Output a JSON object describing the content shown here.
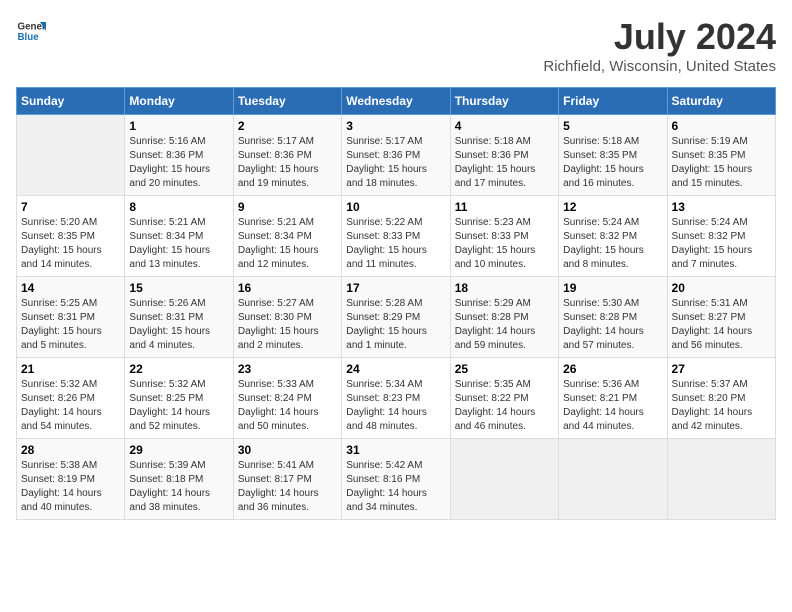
{
  "header": {
    "logo_general": "General",
    "logo_blue": "Blue",
    "title": "July 2024",
    "subtitle": "Richfield, Wisconsin, United States"
  },
  "days_of_week": [
    "Sunday",
    "Monday",
    "Tuesday",
    "Wednesday",
    "Thursday",
    "Friday",
    "Saturday"
  ],
  "weeks": [
    [
      {
        "day": "",
        "info": ""
      },
      {
        "day": "1",
        "info": "Sunrise: 5:16 AM\nSunset: 8:36 PM\nDaylight: 15 hours\nand 20 minutes."
      },
      {
        "day": "2",
        "info": "Sunrise: 5:17 AM\nSunset: 8:36 PM\nDaylight: 15 hours\nand 19 minutes."
      },
      {
        "day": "3",
        "info": "Sunrise: 5:17 AM\nSunset: 8:36 PM\nDaylight: 15 hours\nand 18 minutes."
      },
      {
        "day": "4",
        "info": "Sunrise: 5:18 AM\nSunset: 8:36 PM\nDaylight: 15 hours\nand 17 minutes."
      },
      {
        "day": "5",
        "info": "Sunrise: 5:18 AM\nSunset: 8:35 PM\nDaylight: 15 hours\nand 16 minutes."
      },
      {
        "day": "6",
        "info": "Sunrise: 5:19 AM\nSunset: 8:35 PM\nDaylight: 15 hours\nand 15 minutes."
      }
    ],
    [
      {
        "day": "7",
        "info": "Sunrise: 5:20 AM\nSunset: 8:35 PM\nDaylight: 15 hours\nand 14 minutes."
      },
      {
        "day": "8",
        "info": "Sunrise: 5:21 AM\nSunset: 8:34 PM\nDaylight: 15 hours\nand 13 minutes."
      },
      {
        "day": "9",
        "info": "Sunrise: 5:21 AM\nSunset: 8:34 PM\nDaylight: 15 hours\nand 12 minutes."
      },
      {
        "day": "10",
        "info": "Sunrise: 5:22 AM\nSunset: 8:33 PM\nDaylight: 15 hours\nand 11 minutes."
      },
      {
        "day": "11",
        "info": "Sunrise: 5:23 AM\nSunset: 8:33 PM\nDaylight: 15 hours\nand 10 minutes."
      },
      {
        "day": "12",
        "info": "Sunrise: 5:24 AM\nSunset: 8:32 PM\nDaylight: 15 hours\nand 8 minutes."
      },
      {
        "day": "13",
        "info": "Sunrise: 5:24 AM\nSunset: 8:32 PM\nDaylight: 15 hours\nand 7 minutes."
      }
    ],
    [
      {
        "day": "14",
        "info": "Sunrise: 5:25 AM\nSunset: 8:31 PM\nDaylight: 15 hours\nand 5 minutes."
      },
      {
        "day": "15",
        "info": "Sunrise: 5:26 AM\nSunset: 8:31 PM\nDaylight: 15 hours\nand 4 minutes."
      },
      {
        "day": "16",
        "info": "Sunrise: 5:27 AM\nSunset: 8:30 PM\nDaylight: 15 hours\nand 2 minutes."
      },
      {
        "day": "17",
        "info": "Sunrise: 5:28 AM\nSunset: 8:29 PM\nDaylight: 15 hours\nand 1 minute."
      },
      {
        "day": "18",
        "info": "Sunrise: 5:29 AM\nSunset: 8:28 PM\nDaylight: 14 hours\nand 59 minutes."
      },
      {
        "day": "19",
        "info": "Sunrise: 5:30 AM\nSunset: 8:28 PM\nDaylight: 14 hours\nand 57 minutes."
      },
      {
        "day": "20",
        "info": "Sunrise: 5:31 AM\nSunset: 8:27 PM\nDaylight: 14 hours\nand 56 minutes."
      }
    ],
    [
      {
        "day": "21",
        "info": "Sunrise: 5:32 AM\nSunset: 8:26 PM\nDaylight: 14 hours\nand 54 minutes."
      },
      {
        "day": "22",
        "info": "Sunrise: 5:32 AM\nSunset: 8:25 PM\nDaylight: 14 hours\nand 52 minutes."
      },
      {
        "day": "23",
        "info": "Sunrise: 5:33 AM\nSunset: 8:24 PM\nDaylight: 14 hours\nand 50 minutes."
      },
      {
        "day": "24",
        "info": "Sunrise: 5:34 AM\nSunset: 8:23 PM\nDaylight: 14 hours\nand 48 minutes."
      },
      {
        "day": "25",
        "info": "Sunrise: 5:35 AM\nSunset: 8:22 PM\nDaylight: 14 hours\nand 46 minutes."
      },
      {
        "day": "26",
        "info": "Sunrise: 5:36 AM\nSunset: 8:21 PM\nDaylight: 14 hours\nand 44 minutes."
      },
      {
        "day": "27",
        "info": "Sunrise: 5:37 AM\nSunset: 8:20 PM\nDaylight: 14 hours\nand 42 minutes."
      }
    ],
    [
      {
        "day": "28",
        "info": "Sunrise: 5:38 AM\nSunset: 8:19 PM\nDaylight: 14 hours\nand 40 minutes."
      },
      {
        "day": "29",
        "info": "Sunrise: 5:39 AM\nSunset: 8:18 PM\nDaylight: 14 hours\nand 38 minutes."
      },
      {
        "day": "30",
        "info": "Sunrise: 5:41 AM\nSunset: 8:17 PM\nDaylight: 14 hours\nand 36 minutes."
      },
      {
        "day": "31",
        "info": "Sunrise: 5:42 AM\nSunset: 8:16 PM\nDaylight: 14 hours\nand 34 minutes."
      },
      {
        "day": "",
        "info": ""
      },
      {
        "day": "",
        "info": ""
      },
      {
        "day": "",
        "info": ""
      }
    ]
  ]
}
